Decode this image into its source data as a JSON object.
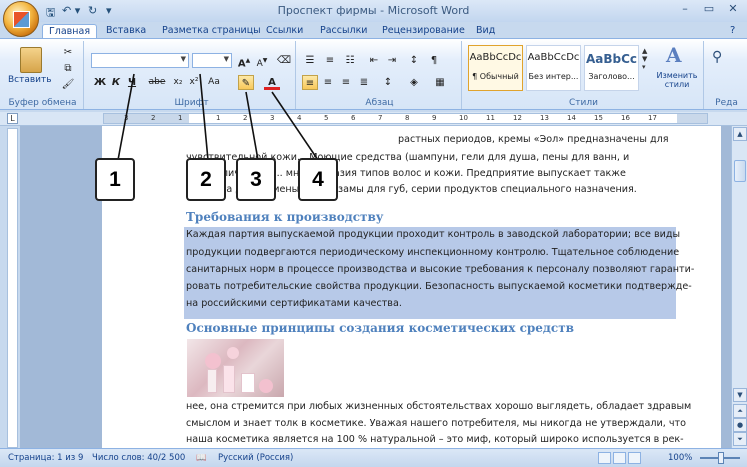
{
  "window": {
    "title": "Проспект фирмы - Microsoft Word",
    "controls": [
      "–",
      "▭",
      "✕"
    ]
  },
  "qat": {
    "save_icon": "save-icon",
    "undo_icon": "undo-icon",
    "redo_icon": "redo-icon"
  },
  "tabs": [
    "Главная",
    "Вставка",
    "Разметка страницы",
    "Ссылки",
    "Рассылки",
    "Рецензирование",
    "Вид"
  ],
  "active_tab": "Главная",
  "ribbon": {
    "groups": {
      "clipboard": "Буфер обмена",
      "font": "Шрифт",
      "paragraph": "Абзац",
      "styles": "Стили",
      "editing": "Реда"
    },
    "paste_label": "Вставить",
    "font_name_value": "",
    "font_size_value": "",
    "font_buttons": [
      "Ж",
      "К",
      "Ч",
      "abe",
      "x₂",
      "x²",
      "Aa"
    ],
    "styles": [
      {
        "sample": "AaBbCcDc",
        "name": "¶ Обычный"
      },
      {
        "sample": "AaBbCcDc",
        "name": "Без интер..."
      },
      {
        "sample": "AaBbCc",
        "name": "Заголово..."
      }
    ],
    "change_styles_label": "Изменить стили"
  },
  "ruler_numbers": [
    "3",
    "2",
    "1",
    "1",
    "2",
    "3",
    "4",
    "5",
    "6",
    "7",
    "8",
    "9",
    "10",
    "11",
    "12",
    "13",
    "14",
    "15",
    "16",
    "17"
  ],
  "callouts": [
    "1",
    "2",
    "3",
    "4"
  ],
  "document": {
    "lines_top": [
      "растных периодов, кремы «Эол» предназначены для",
      "чувствительной кожи... Моющие средства (шампуни, гели для душа, пены для ванн, и",
      "т. д. отличаются ... многообразия типов волос и кожи. Предприятие выпускает также",
      "средства для гигиены ... бальзамы для губ, серии продуктов специального назначения."
    ],
    "heading1": "Требования к производству",
    "para1": [
      "Каждая партия выпускаемой продукции проходит контроль в заводской лаборатории; все виды",
      "продукции подвергаются периодическому инспекционному контролю. Тщательное соблюдение",
      "санитарных норм в процессе производства и высокие требования к персоналу позволяют гаранти-",
      "ровать потребительские свойства продукции. Безопасность выпускаемой косметики подтвержде-",
      "на российскими сертификатами качества."
    ],
    "heading2": "Основные принципы создания косметических средств",
    "para2": [
      "нее, она стремится при любых жизненных обстоятельствах хорошо выглядеть, обладает здравым",
      "смыслом и знает толк в косметике. Уважая нашего потребителя, мы никогда не утверждали, что",
      "наша косметика является на 100 % натуральной – это миф, который широко используется в рек-"
    ]
  },
  "status": {
    "page": "Страница: 1 из 9",
    "words": "Число слов: 40/2 500",
    "language": "Русский (Россия)",
    "zoom": "100%"
  }
}
